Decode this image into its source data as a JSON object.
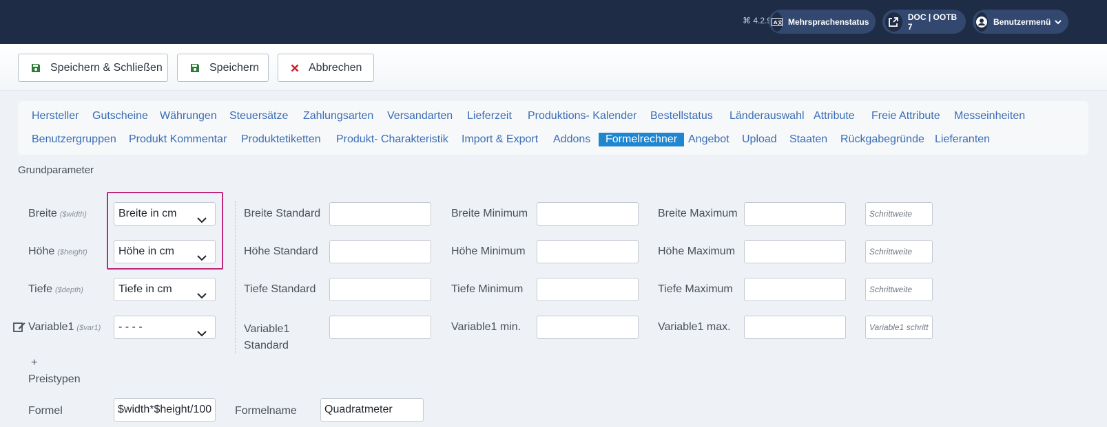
{
  "header": {
    "version": "4.2.9",
    "multilang_label": "Mehrsprachenstatus",
    "site_label": "DOC | OOTB 7",
    "user_menu_label": "Benutzermenü"
  },
  "toolbar": {
    "save_close_label": "Speichern & Schließen",
    "save_label": "Speichern",
    "cancel_label": "Abbrechen"
  },
  "tabs": {
    "row1": [
      "Hersteller",
      "Gutscheine",
      "Währungen",
      "Steuersätze",
      "Zahlungsarten",
      "Versandarten",
      "Lieferzeit",
      "Produktions- Kalender",
      "Bestellstatus",
      "Länderauswahl",
      "Attribute",
      "Freie Attribute",
      "Messeinheiten"
    ],
    "row2": [
      "Benutzergruppen",
      "Produkt Kommentar",
      "Produktetiketten",
      "Produkt- Charakteristik",
      "Import & Export",
      "Addons",
      "Formelrechner",
      "Angebot",
      "Upload",
      "Staaten",
      "Rückgabegründe",
      "Lieferanten"
    ],
    "active": "Formelrechner"
  },
  "section_title": "Grundparameter",
  "params": [
    {
      "label": "Breite",
      "var": "($width)",
      "select": "Breite in cm",
      "std_label": "Breite Standard",
      "min_label": "Breite Minimum",
      "max_label": "Breite Maximum",
      "step_placeholder": "Schrittweite"
    },
    {
      "label": "Höhe",
      "var": "($height)",
      "select": "Höhe in cm",
      "std_label": "Höhe Standard",
      "min_label": "Höhe Minimum",
      "max_label": "Höhe Maximum",
      "step_placeholder": "Schrittweite"
    },
    {
      "label": "Tiefe",
      "var": "($depth)",
      "select": "Tiefe in cm",
      "std_label": "Tiefe Standard",
      "min_label": "Tiefe Minimum",
      "max_label": "Tiefe Maximum",
      "step_placeholder": "Schrittweite"
    },
    {
      "label": "Variable1",
      "var": "($var1)",
      "select": "- - - -",
      "std_label_1": "Variable1",
      "std_label_2": "Standard",
      "min_label": "Variable1 min.",
      "max_label": "Variable1 max.",
      "step_placeholder": "Variable1 schritt"
    }
  ],
  "add_price_types": {
    "plus": "+",
    "label": "Preistypen"
  },
  "formula": {
    "label": "Formel",
    "value": "$width*$height/100",
    "name_label": "Formelname",
    "name_value": "Quadratmeter"
  }
}
